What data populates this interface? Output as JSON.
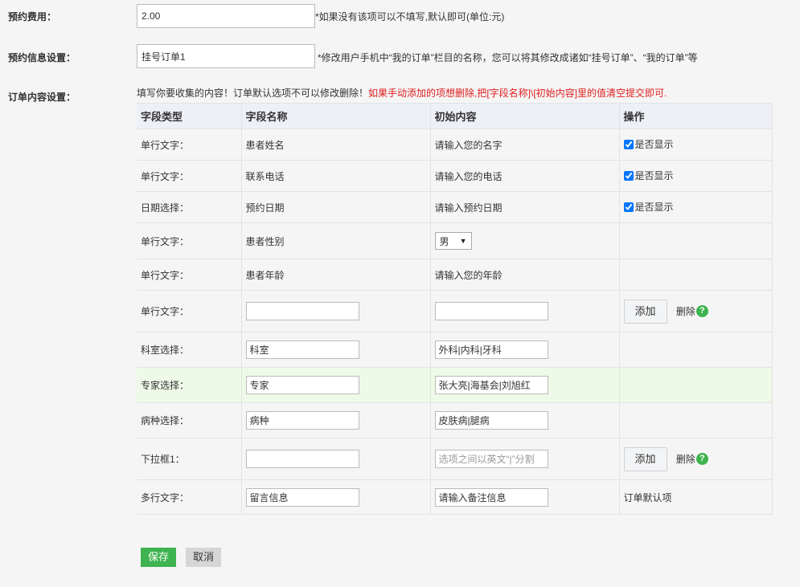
{
  "fee": {
    "label": "预约费用：",
    "value": "2.00",
    "hint": "*如果没有该项可以不填写,默认即可(单位:元)"
  },
  "info": {
    "label": "预约信息设置：",
    "value": "挂号订单1",
    "hint": "*修改用户手机中“我的订单”栏目的名称，您可以将其修改成诸如“挂号订单”、“我的订单”等"
  },
  "order": {
    "label": "订单内容设置：",
    "hint_plain": "填写你要收集的内容！订单默认选项不可以修改删除！",
    "hint_red": "如果手动添加的项想删除,把[字段名称]\\[初始内容]里的值清空提交即可."
  },
  "table": {
    "headers": [
      "字段类型",
      "字段名称",
      "初始内容",
      "操作"
    ],
    "rows": [
      {
        "type": "单行文字：",
        "name": "患者姓名",
        "content": "请输入您的名字",
        "op": "是否显示"
      },
      {
        "type": "单行文字：",
        "name": "联系电话",
        "content": "请输入您的电话",
        "op": "是否显示"
      },
      {
        "type": "日期选择：",
        "name": "预约日期",
        "content": "请输入预约日期",
        "op": "是否显示"
      },
      {
        "type": "单行文字：",
        "name": "患者性别",
        "select_value": "男"
      },
      {
        "type": "单行文字：",
        "name": "患者年龄",
        "content": "请输入您的年龄"
      },
      {
        "type": "单行文字：",
        "name_input": "",
        "content_input": "",
        "add_label": "添加",
        "delete_label": "删除"
      },
      {
        "type": "科室选择：",
        "name_input": "科室",
        "content_input": "外科|内科|牙科"
      },
      {
        "type": "专家选择：",
        "name_input": "专家",
        "content_input": "张大亮|海基会|刘旭红"
      },
      {
        "type": "病种选择：",
        "name_input": "病种",
        "content_input": "皮肤病|腿病"
      },
      {
        "type": "下拉框1：",
        "name_input": "",
        "content_placeholder": "选项之间以英文“|”分割",
        "add_label": "添加",
        "delete_label": "删除"
      },
      {
        "type": "多行文字：",
        "name_input": "留言信息",
        "content_input": "请输入备注信息",
        "op": "订单默认项"
      }
    ]
  },
  "buttons": {
    "save": "保存",
    "cancel": "取消"
  },
  "icons": {
    "help": "?"
  },
  "colors": {
    "primary_green": "#3eb34f",
    "warning_red": "#e02020",
    "highlight_row": "#eefae8"
  }
}
